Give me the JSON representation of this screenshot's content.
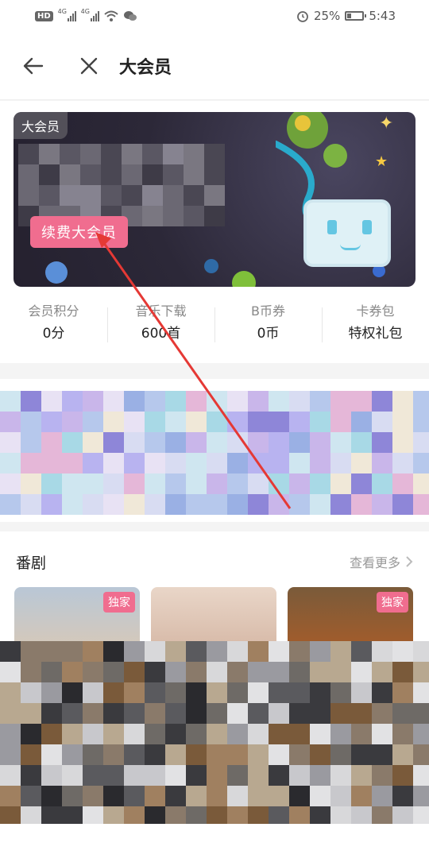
{
  "status_bar": {
    "hd_label": "HD",
    "net1": "4G",
    "net2": "4G",
    "battery": "25%",
    "battery_level": 0.25,
    "time": "5:43"
  },
  "header": {
    "title": "大会员"
  },
  "banner": {
    "tag": "大会员",
    "renew_button": "续费大会员"
  },
  "stats": [
    {
      "label": "会员积分",
      "value": "0分"
    },
    {
      "label": "音乐下载",
      "value": "600首"
    },
    {
      "label": "B币券",
      "value": "0币"
    },
    {
      "label": "卡券包",
      "value": "特权礼包"
    }
  ],
  "section": {
    "title": "番剧",
    "more": "查看更多"
  },
  "cards": [
    {
      "badge": "独家"
    },
    {
      "badge": ""
    },
    {
      "badge": "独家"
    }
  ],
  "colors": {
    "accent": "#f06d8f",
    "annotation": "#e53935"
  }
}
